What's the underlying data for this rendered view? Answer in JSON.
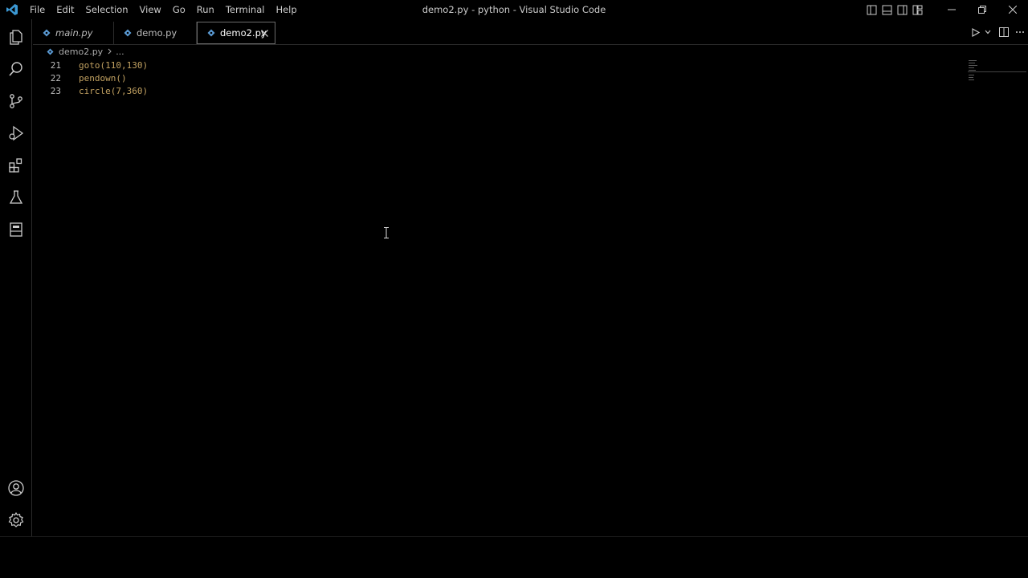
{
  "window": {
    "title": "demo2.py - python - Visual Studio Code"
  },
  "menu": [
    "File",
    "Edit",
    "Selection",
    "View",
    "Go",
    "Run",
    "Terminal",
    "Help"
  ],
  "tabs": [
    {
      "label": "main.py",
      "italic": true,
      "active": false
    },
    {
      "label": "demo.py",
      "italic": false,
      "active": false
    },
    {
      "label": "demo2.py",
      "italic": false,
      "active": true
    }
  ],
  "breadcrumb": {
    "file": "demo2.py",
    "rest": "..."
  },
  "editor": {
    "lines": [
      {
        "number": "21",
        "code": "goto(110,130)"
      },
      {
        "number": "22",
        "code": "pendown()"
      },
      {
        "number": "23",
        "code": "circle(7,360)"
      }
    ]
  },
  "icons": {
    "activity_top": [
      "explorer-icon",
      "search-icon",
      "source-control-icon",
      "run-debug-icon",
      "extensions-icon",
      "testing-icon",
      "remote-explorer-icon"
    ],
    "activity_bottom": [
      "account-icon",
      "settings-gear-icon"
    ]
  },
  "colors": {
    "background": "#000000",
    "python_icon": "#5b9bd5",
    "code_text": "#c0a060",
    "logo": "#3c99d4"
  }
}
